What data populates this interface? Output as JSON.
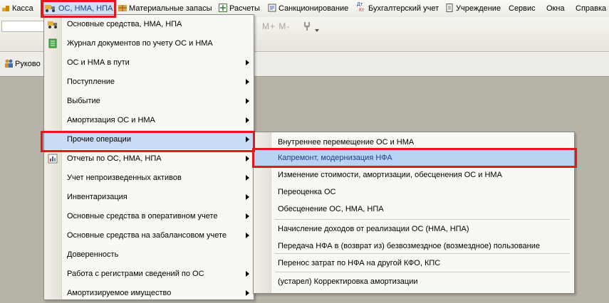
{
  "menubar": {
    "items": [
      "Касса",
      "ОС, НМА, НПА",
      "Материальные запасы",
      "Расчеты",
      "Санкционирование",
      "Бухгалтерский учет",
      "Учреждение",
      "Сервис",
      "Окна",
      "Справка"
    ],
    "kt_icon": {
      "top": "Дт",
      "bottom": "Кт"
    }
  },
  "toolbar": {
    "buttons_text": "M+ M-"
  },
  "panel": {
    "truncated_label": "Руково"
  },
  "menu": {
    "items": [
      {
        "label": "Основные средства, НМА, НПА",
        "icon": "truck-icon",
        "submenu": false
      },
      {
        "label": "Журнал документов по учету ОС и НМА",
        "icon": "journal-icon",
        "submenu": false
      },
      {
        "label": "ОС и НМА в пути",
        "icon": "",
        "submenu": true
      },
      {
        "label": "Поступление",
        "icon": "",
        "submenu": true
      },
      {
        "label": "Выбытие",
        "icon": "",
        "submenu": true
      },
      {
        "label": "Амортизация ОС и НМА",
        "icon": "",
        "submenu": true
      },
      {
        "label": "Прочие операции",
        "icon": "",
        "submenu": true,
        "highlighted": true
      },
      {
        "label": "Отчеты по ОС, НМА, НПА",
        "icon": "report-icon",
        "submenu": true
      },
      {
        "label": "Учет непроизведенных активов",
        "icon": "",
        "submenu": true
      },
      {
        "label": "Инвентаризация",
        "icon": "",
        "submenu": true
      },
      {
        "label": "Основные средства в оперативном учете",
        "icon": "",
        "submenu": true
      },
      {
        "label": "Основные средства на забалансовом учете",
        "icon": "",
        "submenu": true
      },
      {
        "label": "Доверенность",
        "icon": "",
        "submenu": false
      },
      {
        "label": "Работа с регистрами сведений по ОС",
        "icon": "",
        "submenu": true
      },
      {
        "label": "Амортизируемое имущество",
        "icon": "",
        "submenu": true
      }
    ]
  },
  "submenu": {
    "items": [
      {
        "label": "Внутреннее перемещение ОС и НМА"
      },
      {
        "label": "Капремонт, модернизация НФА",
        "highlighted": true
      },
      {
        "label": "Изменение стоимости, амортизации, обесценения ОС и НМА"
      },
      {
        "label": "Переоценка ОС"
      },
      {
        "label": "Обесценение ОС, НМА, НПА"
      },
      {
        "label": "Начисление доходов от реализации ОС (НМА, НПА)"
      },
      {
        "label": "Передача НФА в (возврат из) безвозмездное (возмездное) пользование"
      },
      {
        "label": "Перенос затрат по НФА на другой КФО, КПС"
      },
      {
        "label": "(устарел) Корректировка амортизации"
      }
    ]
  },
  "colors": {
    "highlight": "#e0191e",
    "selection": "#c9dcf6",
    "selected_text": "#1a3f8a"
  }
}
